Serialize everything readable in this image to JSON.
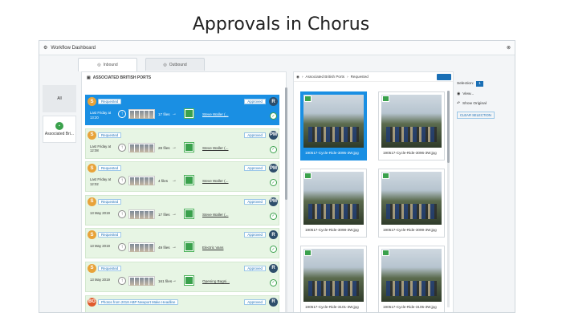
{
  "page_title": "Approvals in Chorus",
  "window": {
    "title": "Workflow Dashboard",
    "close_glyph": "⊗"
  },
  "tabs": [
    {
      "label": "Inbound",
      "active": true
    },
    {
      "label": "Outbound",
      "active": false
    }
  ],
  "leftnav": [
    {
      "label": "All",
      "active": false
    },
    {
      "label": "Associated Bri...",
      "active": true
    }
  ],
  "main": {
    "header": "ASSOCIATED BRITISH PORTS"
  },
  "rows": [
    {
      "badge": "S",
      "badge_color": "#e8a33a",
      "status": "Requested",
      "when": "Last Friday at 13:20",
      "files": "17 files",
      "to": "Steve Waller (...",
      "approved": "Approved",
      "avatar": "R",
      "selected": true
    },
    {
      "badge": "S",
      "badge_color": "#e8a33a",
      "status": "Requested",
      "when": "Last Friday at 12:08",
      "files": "28 files",
      "to": "Steve Waller (...",
      "approved": "Approved",
      "avatar": "PM",
      "selected": false
    },
    {
      "badge": "S",
      "badge_color": "#e8a33a",
      "status": "Requested",
      "when": "Last Friday at 12:02",
      "files": "4 files",
      "to": "Steve Waller (...",
      "approved": "Approved",
      "avatar": "PM",
      "selected": false
    },
    {
      "badge": "S",
      "badge_color": "#e8a33a",
      "status": "Requested",
      "when": "13 May 2019",
      "files": "17 files",
      "to": "Steve Waller (...",
      "approved": "Approved",
      "avatar": "PM",
      "selected": false
    },
    {
      "badge": "S",
      "badge_color": "#e8a33a",
      "status": "Requested",
      "when": "13 May 2019",
      "files": "49 files",
      "to": "Electric Vans",
      "approved": "Approved",
      "avatar": "R",
      "selected": false
    },
    {
      "badge": "S",
      "badge_color": "#e8a33a",
      "status": "Requested",
      "when": "13 May 2019",
      "files": "161 files",
      "to": "Opening Bagsi...",
      "approved": "Approved",
      "avatar": "R",
      "selected": false
    },
    {
      "badge": "BG",
      "badge_color": "#e05a2b",
      "status": "Photos from 2018 ABP Newport Make Headline",
      "when": "",
      "files": "",
      "to": "",
      "approved": "Approved",
      "avatar": "R",
      "selected": false
    }
  ],
  "gallery": {
    "breadcrumb": [
      "Associated British Ports",
      "Requested"
    ],
    "cards": [
      {
        "caption": "190517-Cycle-Ride-3095-3W.jpg",
        "selected": true
      },
      {
        "caption": "190517-Cycle-Ride-3096-3W.jpg",
        "selected": false
      },
      {
        "caption": "190517-Cycle-Ride-3098-3W.jpg",
        "selected": false
      },
      {
        "caption": "190517-Cycle-Ride-3099-3W.jpg",
        "selected": false
      },
      {
        "caption": "190517-Cycle-Ride-3101-3W.jpg",
        "selected": false
      },
      {
        "caption": "190517-Cycle-Ride-3105-3W.jpg",
        "selected": false
      }
    ]
  },
  "side": {
    "selection_label": "Selection:",
    "selection_count": "1",
    "view_label": "View...",
    "show_original": "Show Original",
    "clear_selection": "CLEAR SELECTION"
  }
}
